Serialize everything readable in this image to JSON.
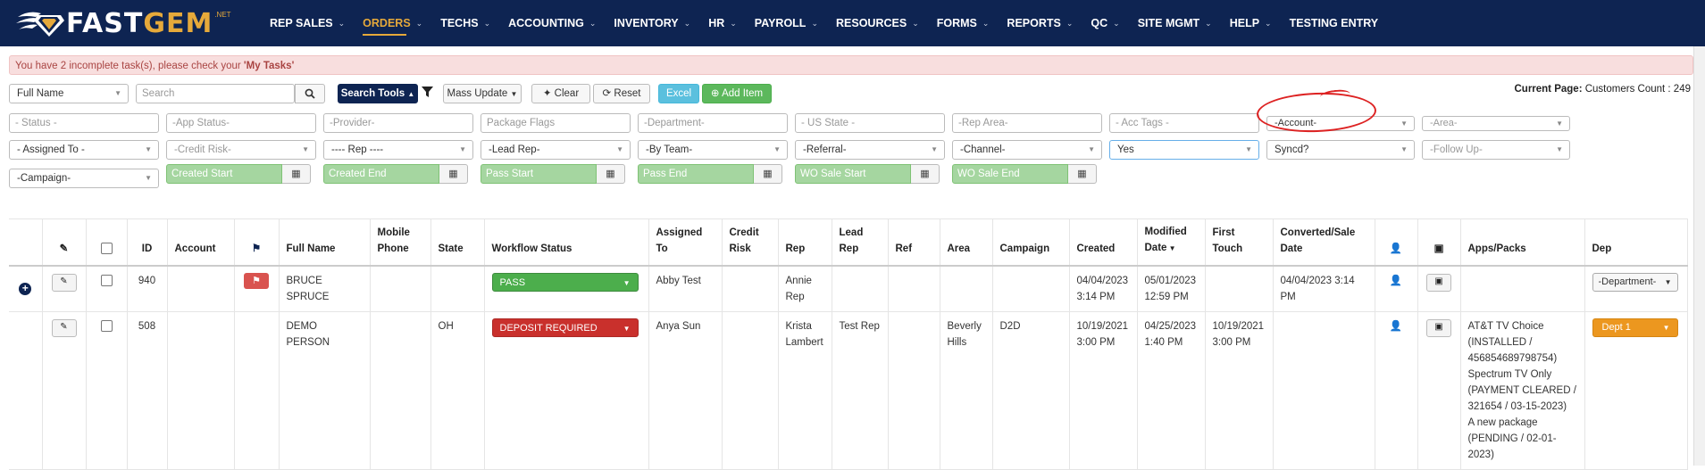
{
  "nav": {
    "logo": {
      "text_a": "FAST",
      "text_b": "GEM",
      "suffix": ".NET"
    },
    "items": [
      {
        "label": "REP SALES",
        "active": false
      },
      {
        "label": "ORDERS",
        "active": true
      },
      {
        "label": "TECHS",
        "active": false
      },
      {
        "label": "ACCOUNTING",
        "active": false
      },
      {
        "label": "INVENTORY",
        "active": false
      },
      {
        "label": "HR",
        "active": false
      },
      {
        "label": "PAYROLL",
        "active": false
      },
      {
        "label": "RESOURCES",
        "active": false
      },
      {
        "label": "FORMS",
        "active": false
      },
      {
        "label": "REPORTS",
        "active": false
      },
      {
        "label": "QC",
        "active": false
      },
      {
        "label": "SITE MGMT",
        "active": false
      },
      {
        "label": "HELP",
        "active": false
      },
      {
        "label": "TESTING ENTRY",
        "active": false
      }
    ]
  },
  "alert": {
    "text_before": "You have 2 incomplete task(s), please check your ",
    "link": "'My Tasks'"
  },
  "toolbar": {
    "field_select": "Full Name",
    "search_placeholder": "Search",
    "search_tools": "Search Tools",
    "mass_update": "Mass Update",
    "clear": "Clear",
    "reset": "Reset",
    "excel": "Excel",
    "add_item": "Add Item"
  },
  "count": {
    "label": "Current Page:",
    "text": "Customers Count : 249"
  },
  "filters": {
    "row1": [
      "- Status -",
      "-App Status-",
      "-Provider-",
      "Package Flags",
      "-Department-",
      "- US State -",
      "-Rep Area-",
      "- Acc Tags -",
      "-Account-",
      "-Area-"
    ],
    "row2": [
      "- Assigned To -",
      "-Credit Risk-",
      "---- Rep ----",
      "-Lead Rep-",
      "-By Team-",
      "-Referral-",
      "-Channel-",
      "Yes",
      "Syncd?",
      "-Follow Up-"
    ],
    "campaign": "-Campaign-",
    "dates": [
      "Created Start",
      "Created End",
      "Pass Start",
      "Pass End",
      "WO Sale Start",
      "WO Sale End"
    ]
  },
  "table": {
    "headers": {
      "id": "ID",
      "account": "Account",
      "full_name": "Full Name",
      "mobile": "Mobile Phone",
      "state": "State",
      "workflow": "Workflow Status",
      "assigned": "Assigned To",
      "credit": "Credit Risk",
      "rep": "Rep",
      "lead_rep": "Lead Rep",
      "ref": "Ref",
      "area": "Area",
      "campaign": "Campaign",
      "created": "Created",
      "modified": "Modified Date",
      "first_touch": "First Touch",
      "converted": "Converted/Sale Date",
      "apps": "Apps/Packs",
      "dep": "Dep"
    },
    "rows": [
      {
        "id": "940",
        "full_name": "BRUCE SPRUCE",
        "mobile": "",
        "state": "",
        "workflow": "PASS",
        "workflow_color": "#4cae4c",
        "assigned": "Abby Test",
        "credit": "",
        "rep": "Annie Rep",
        "lead_rep": "",
        "ref": "",
        "area": "",
        "campaign": "",
        "created": "04/04/2023 3:14 PM",
        "modified": "05/01/2023 12:59 PM",
        "first_touch": "",
        "converted": "04/04/2023 3:14 PM",
        "apps": "",
        "dep": "-Department-"
      },
      {
        "id": "508",
        "full_name": "DEMO PERSON",
        "mobile": "",
        "state": "OH",
        "workflow": "DEPOSIT REQUIRED",
        "workflow_color": "#c9302c",
        "assigned": "Anya Sun",
        "credit": "",
        "rep": "Krista Lambert",
        "lead_rep": "Test Rep",
        "ref": "",
        "area": "Beverly Hills",
        "campaign": "D2D",
        "created": "10/19/2021 3:00 PM",
        "modified": "04/25/2023 1:40 PM",
        "first_touch": "10/19/2021 3:00 PM",
        "converted": "",
        "apps_lines": [
          "AT&T TV Choice (INSTALLED / 456854689798754)",
          "Spectrum TV Only (PAYMENT CLEARED / 321654 / 03-15-2023)",
          "A new package (PENDING / 02-01-2023)"
        ],
        "dep": "Dept 1"
      }
    ]
  }
}
